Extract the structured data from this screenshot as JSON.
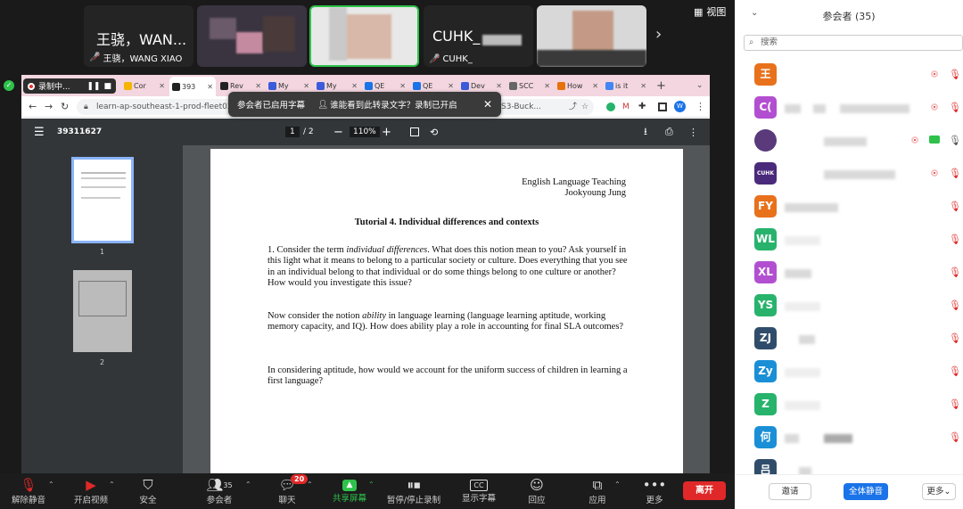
{
  "strip": {
    "tiles": [
      {
        "big": "王骁，WAN...",
        "caption": "王骁，WANG XIAO"
      },
      {
        "big": "",
        "caption": ""
      },
      {
        "big": "",
        "caption": ""
      },
      {
        "big": "CUHK_",
        "caption": "CUHK_"
      },
      {
        "big": "",
        "caption": ""
      }
    ],
    "view_label": "视图"
  },
  "browser": {
    "recording_label": "录制中...",
    "tabs": [
      {
        "label": "Cor",
        "color": "#f4b400"
      },
      {
        "label": "393",
        "color": "#222222"
      },
      {
        "label": "Rev",
        "color": "#222222"
      },
      {
        "label": "My",
        "color": "#3b5bdb"
      },
      {
        "label": "My",
        "color": "#3b5bdb"
      },
      {
        "label": "QE",
        "color": "#1a73e8"
      },
      {
        "label": "QE",
        "color": "#1a73e8"
      },
      {
        "label": "Dev",
        "color": "#3b5bdb"
      },
      {
        "label": "SCC",
        "color": "#666666"
      },
      {
        "label": "How",
        "color": "#e8710a"
      },
      {
        "label": "is it",
        "color": "#4285f4"
      }
    ],
    "url": "learn-ap-southeast-1-prod-fleet02-xyth",
    "url_tail": "S3-Buck...",
    "caption_popup": {
      "title": "参会者已启用字幕",
      "question": "谁能看到此转录文字？录制已开启"
    }
  },
  "pdf": {
    "doc_id": "39311627",
    "page_current": "1",
    "page_total": "/ 2",
    "zoom": "110%",
    "thumb_labels": [
      "1",
      "2"
    ],
    "header_line1": "English Language Teaching",
    "header_line2": "Jookyoung Jung",
    "title": "Tutorial 4. Individual differences and contexts",
    "q1_pre": "1. Consider the term ",
    "q1_em": "individual differences",
    "q1_post": ". What does this notion mean to you? Ask yourself in this light what it means to belong to a particular society or culture. Does everything that you see in an individual belong to that individual or do some things belong to one culture or another? How would you investigate this issue?",
    "q2_pre": "Now consider the notion ",
    "q2_em": "ability",
    "q2_post": " in language learning (language learning aptitude, working memory capacity, and IQ). How does ability play a role in accounting for final SLA outcomes?",
    "q3": "In considering aptitude, how would we account for the uniform success of children in learning a first language?"
  },
  "toolbar": {
    "mute": "解除静音",
    "video": "开启视频",
    "security": "安全",
    "participants": "参会者",
    "participants_count": "35",
    "chat": "聊天",
    "chat_badge": "20",
    "share": "共享屏幕",
    "record": "暂停/停止录制",
    "captions": "显示字幕",
    "reactions": "回应",
    "apps": "应用",
    "more": "更多",
    "leave": "离开"
  },
  "panel": {
    "title": "参会者 (35)",
    "search_placeholder": "搜索",
    "participants": [
      {
        "initial": "王",
        "color": "#e8711c"
      },
      {
        "initial": "C(",
        "color": "#b24fd1"
      },
      {
        "initial": "",
        "color": "#5a3a7a"
      },
      {
        "initial": "CUHK",
        "color": "#4a2a7a"
      },
      {
        "initial": "FY",
        "color": "#e8711c"
      },
      {
        "initial": "WL",
        "color": "#27b36b"
      },
      {
        "initial": "XL",
        "color": "#b24fd1"
      },
      {
        "initial": "YS",
        "color": "#27b36b"
      },
      {
        "initial": "ZJ",
        "color": "#2f4d6b"
      },
      {
        "initial": "Zy",
        "color": "#1a8fd6"
      },
      {
        "initial": "Z",
        "color": "#27b36b"
      },
      {
        "initial": "何",
        "color": "#1a8fd6"
      },
      {
        "initial": "吕",
        "color": "#2f4d6b"
      }
    ],
    "invite": "邀请",
    "mute_all": "全体静音",
    "more": "更多"
  }
}
